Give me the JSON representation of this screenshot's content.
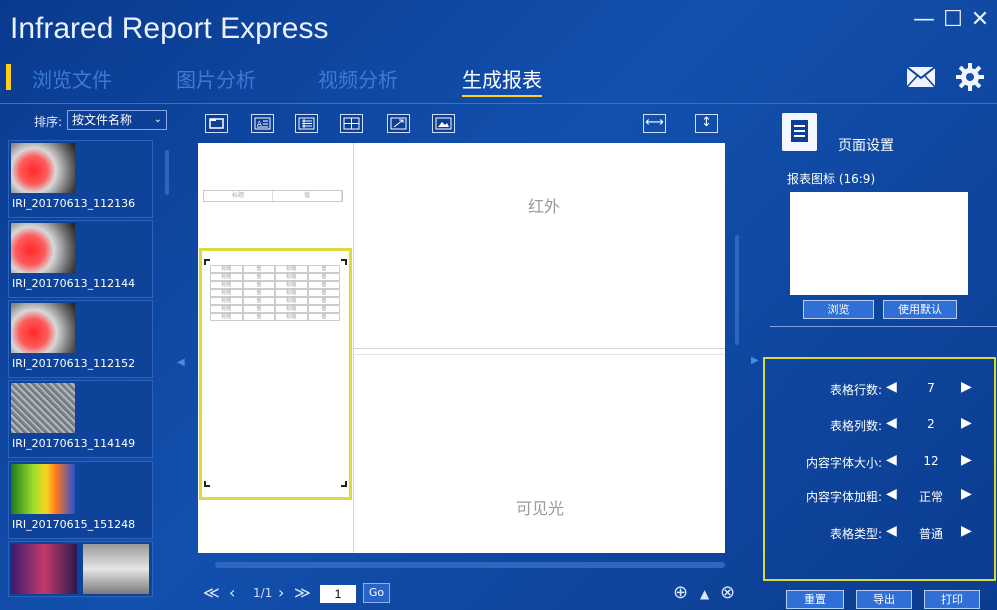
{
  "app": {
    "title": "Infrared Report Express"
  },
  "window": {
    "minimize": "—",
    "maximize": "☐",
    "close": "✕"
  },
  "tabs": [
    {
      "label": "浏览文件"
    },
    {
      "label": "图片分析"
    },
    {
      "label": "视频分析"
    },
    {
      "label": "生成报表",
      "active": true
    }
  ],
  "sort": {
    "label": "排序:",
    "value": "按文件名称"
  },
  "files": [
    {
      "name": "IRI_20170613_112136",
      "type": "thermal"
    },
    {
      "name": "IRI_20170613_112144",
      "type": "thermal"
    },
    {
      "name": "IRI_20170613_112152",
      "type": "thermal"
    },
    {
      "name": "IRI_20170613_114149",
      "type": "noise"
    },
    {
      "name": "IRI_20170615_151248",
      "type": "color-thermal"
    },
    {
      "name": "",
      "type": "pair"
    }
  ],
  "canvas": {
    "infrared_label": "红外",
    "visible_label": "可见光",
    "cell_key": "标题",
    "cell_value": "值"
  },
  "pager": {
    "first": "≪",
    "prev": "‹",
    "info": "1/1",
    "next": "›",
    "last": "≫",
    "page": "1",
    "go": "Go"
  },
  "zoom": {
    "in": "⊕",
    "up": "▲",
    "out": "⊗"
  },
  "right": {
    "page_settings": "页面设置",
    "report_logo": "报表图标 (16:9)",
    "browse": "浏览",
    "use_default": "使用默认"
  },
  "settings": [
    {
      "label": "表格行数:",
      "value": "7"
    },
    {
      "label": "表格列数:",
      "value": "2"
    },
    {
      "label": "内容字体大小:",
      "value": "12"
    },
    {
      "label": "内容字体加粗:",
      "value": "正常"
    },
    {
      "label": "表格类型:",
      "value": "普通"
    }
  ],
  "bottom_buttons": {
    "reset": "重置",
    "export": "导出",
    "print": "打印"
  },
  "colors": {
    "accent": "#ffd21f",
    "selection": "#d9dc3a",
    "background": "#1250ae"
  }
}
